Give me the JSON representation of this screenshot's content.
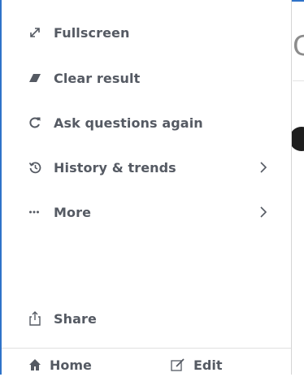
{
  "menu": {
    "items": [
      {
        "label": "Fullscreen",
        "icon": "expand-icon"
      },
      {
        "label": "Clear result",
        "icon": "eraser-icon"
      },
      {
        "label": "Ask questions again",
        "icon": "refresh-icon"
      },
      {
        "label": "History & trends",
        "icon": "history-icon",
        "has_submenu": true
      },
      {
        "label": "More",
        "icon": "more-icon",
        "has_submenu": true
      }
    ],
    "share_label": "Share",
    "home_label": "Home",
    "edit_label": "Edit"
  },
  "background": {
    "partial_text": "G"
  },
  "colors": {
    "accent": "#2f73c9",
    "text": "#555a63"
  }
}
